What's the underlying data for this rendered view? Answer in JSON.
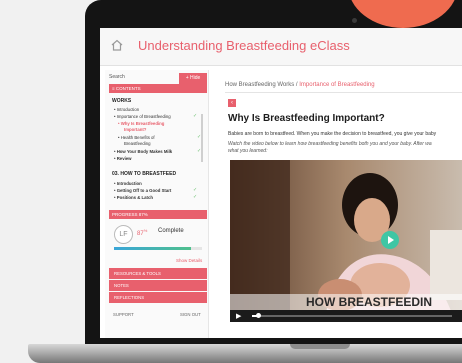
{
  "app": {
    "title": "Understanding Breastfeeding eClass"
  },
  "sidebar": {
    "search_label": "Search",
    "hide_label": "+ Hide",
    "contents_label": "≡ CONTENTS",
    "section_works": "WORKS",
    "items_top": [
      {
        "label": "• Introduction",
        "state": "done"
      },
      {
        "label": "• Importance of Breastfeeding",
        "state": "done"
      },
      {
        "label": "• Why Is Breastfeeding",
        "state": "active"
      },
      {
        "label": "Important?",
        "state": "active-cont"
      },
      {
        "label": "• Health Benefits of",
        "state": "done"
      },
      {
        "label": "Breastfeeding",
        "state": "cont"
      },
      {
        "label": "• How Your Body Makes Milk",
        "state": "done"
      },
      {
        "label": "• Review",
        "state": "done"
      }
    ],
    "section_breastfeed": "03. HOW TO BREASTFEED",
    "items_bottom": [
      {
        "label": "• Introduction",
        "state": "done"
      },
      {
        "label": "• Getting Off to a Good Start",
        "state": "done"
      },
      {
        "label": "• Positions & Latch",
        "state": "done"
      }
    ],
    "progress_header": "PROGRESS 87%",
    "avatar_initials": "LF",
    "progress_value": "87",
    "progress_unit": "%",
    "progress_status": "Complete",
    "progress_fraction": 0.87,
    "show_details": "Show Details",
    "menu": [
      {
        "label": "RESOURCES & TOOLS"
      },
      {
        "label": "NOTES"
      },
      {
        "label": "REFLECTIONS"
      }
    ],
    "support_label": "SUPPORT",
    "signout_label": "SIGN OUT"
  },
  "main": {
    "breadcrumb_parent": "How Breastfeeding Works /",
    "breadcrumb_current": "Importance of Breastfeeding",
    "lesson_title": "Why Is Breastfeeding Important?",
    "body_text": "Babies are born to breastfeed. When you make the decision to breastfeed, you give your baby",
    "italic_line1": "Watch the video below to learn how breastfeeding benefits both you and your baby. After wa",
    "italic_line2": "what you learned:",
    "video_banner": "HOW BREASTFEEDIN"
  },
  "colors": {
    "accent": "#e8606d",
    "check": "#6cc070",
    "play": "#3fc6a4"
  }
}
